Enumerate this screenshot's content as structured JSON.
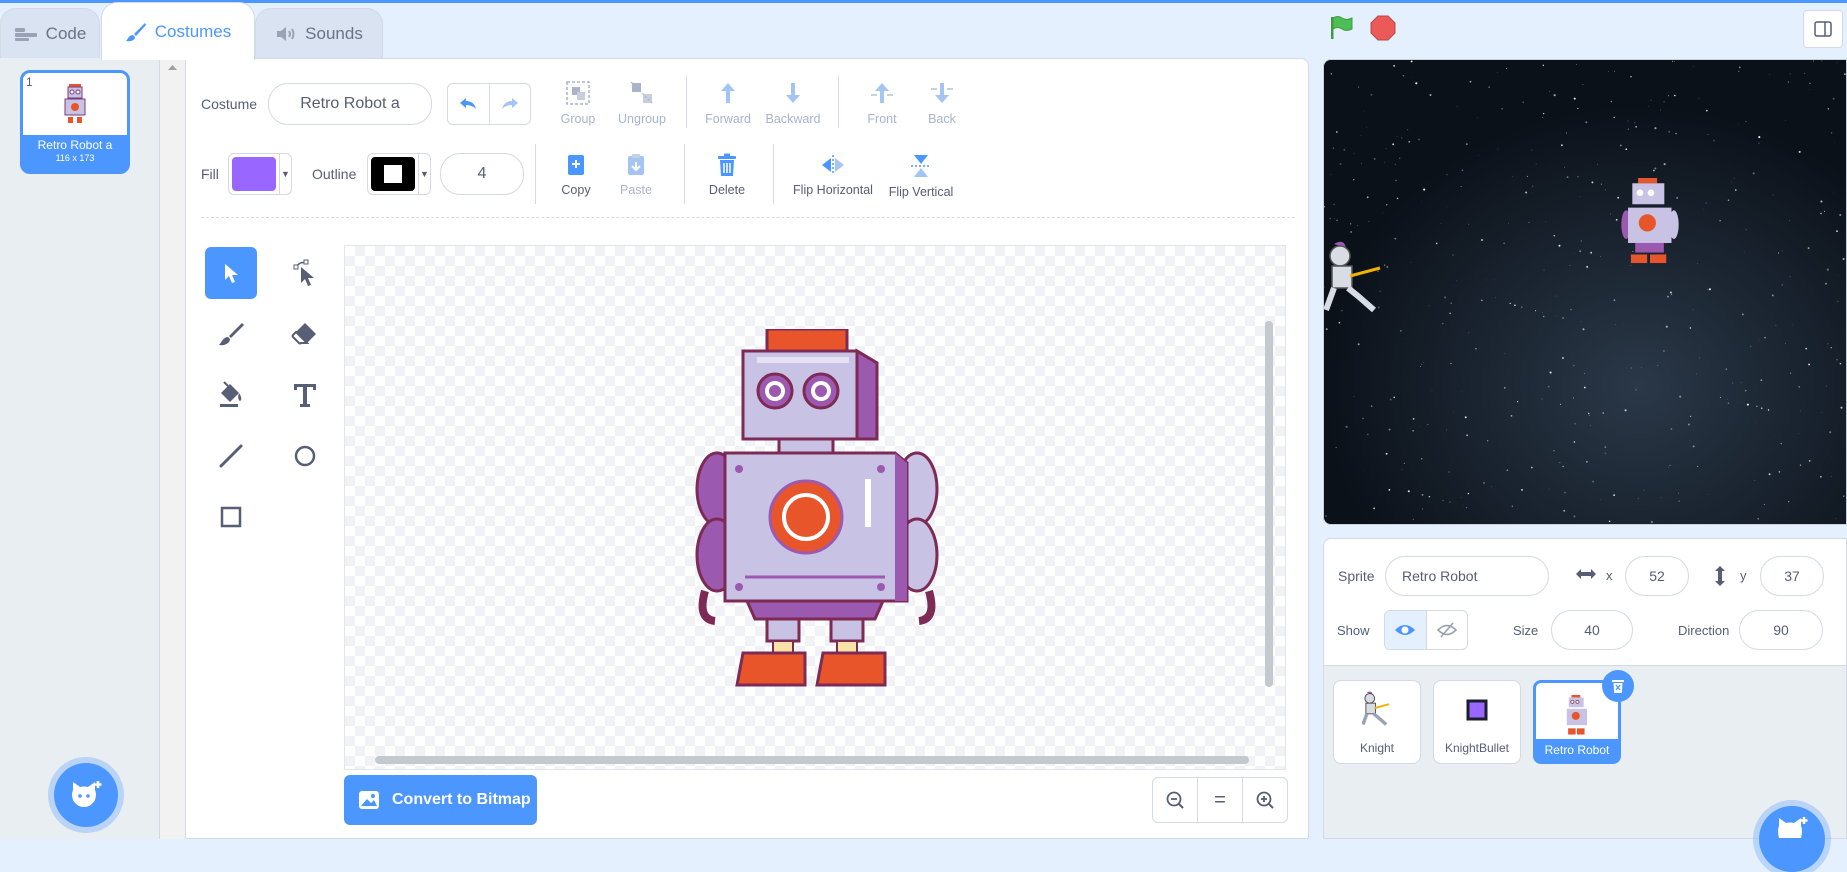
{
  "tabs": {
    "code": "Code",
    "costumes": "Costumes",
    "sounds": "Sounds"
  },
  "costume_list": [
    {
      "number": "1",
      "name": "Retro Robot a",
      "size": "116 x 173"
    }
  ],
  "toolbar": {
    "costume_label": "Costume",
    "costume_name": "Retro Robot a",
    "group": "Group",
    "ungroup": "Ungroup",
    "forward": "Forward",
    "backward": "Backward",
    "front": "Front",
    "back": "Back",
    "fill_label": "Fill",
    "fill_color": "#9966ff",
    "outline_label": "Outline",
    "outline_color": "#000000",
    "outline_width": "4",
    "copy": "Copy",
    "paste": "Paste",
    "delete": "Delete",
    "flip_horizontal": "Flip Horizontal",
    "flip_vertical": "Flip Vertical"
  },
  "tools": [
    "select-icon",
    "reshape-icon",
    "brush-icon",
    "eraser-icon",
    "fill-icon",
    "text-icon",
    "line-icon",
    "circle-icon",
    "rectangle-icon"
  ],
  "convert_label": "Convert to Bitmap",
  "zoom_reset": "=",
  "sprite_info": {
    "sprite_label": "Sprite",
    "sprite_name": "Retro Robot",
    "x_label": "x",
    "x_value": "52",
    "y_label": "y",
    "y_value": "37",
    "show_label": "Show",
    "size_label": "Size",
    "size_value": "40",
    "direction_label": "Direction",
    "direction_value": "90"
  },
  "sprites": [
    {
      "name": "Knight"
    },
    {
      "name": "KnightBullet"
    },
    {
      "name": "Retro Robot"
    }
  ],
  "colors": {
    "accent": "#4c97ff",
    "flag": "#4cbf56",
    "stop": "#ec5959"
  }
}
